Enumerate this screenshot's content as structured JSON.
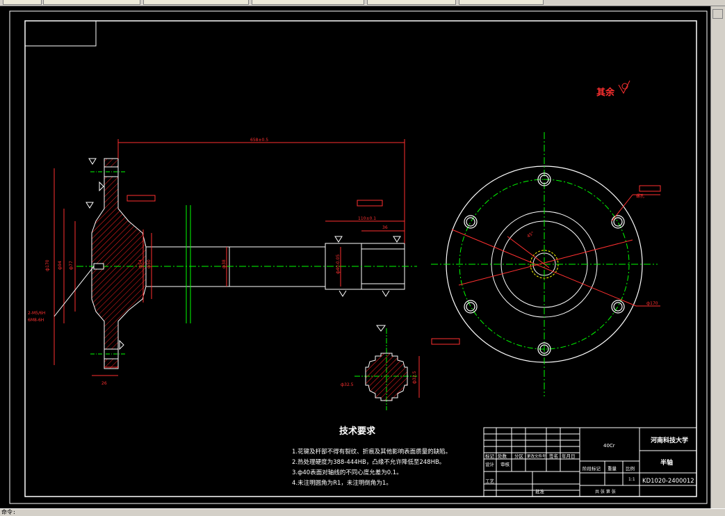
{
  "window": {
    "tabs": [
      "",
      "",
      "",
      "",
      ""
    ],
    "status_text": "命令:"
  },
  "drawing": {
    "surface_finish_note": "其余",
    "tech_req_title": "技术要求",
    "tech_requirements": [
      "1.花键及杆部不得有裂纹、折痕及其他影响表面质量的缺陷。",
      "2.热处理硬度为388-444HB，凸缘不允许降低至248HB。",
      "3.ф40表面对轴线的不同心度允差为0.1。",
      "4.未注明圆角为R1，未注明倒角为1。"
    ],
    "dimensions": {
      "overall_length": "658±0.5",
      "flange_dia": "ф170",
      "flange_width": "26",
      "spline_len": "36",
      "bolt_circle": "ф170",
      "section_dia": "ф32.5",
      "hole_note_1": "2-M5/6H",
      "hole_note_2": "6M8-6H"
    }
  },
  "title_block": {
    "school": "河南科技大学",
    "part_name": "半轴",
    "material": "40Cr",
    "drawing_no": "KD1020-2400012",
    "scale": "1:1",
    "sheet": "共 张 第 张",
    "row_labels": [
      "标记",
      "处数",
      "分区",
      "更改文件号",
      "签名",
      "年月日"
    ],
    "roles": [
      "设计",
      "审核",
      "工艺",
      "批准"
    ],
    "attrs": [
      "阶段标记",
      "重量",
      "比例"
    ]
  }
}
